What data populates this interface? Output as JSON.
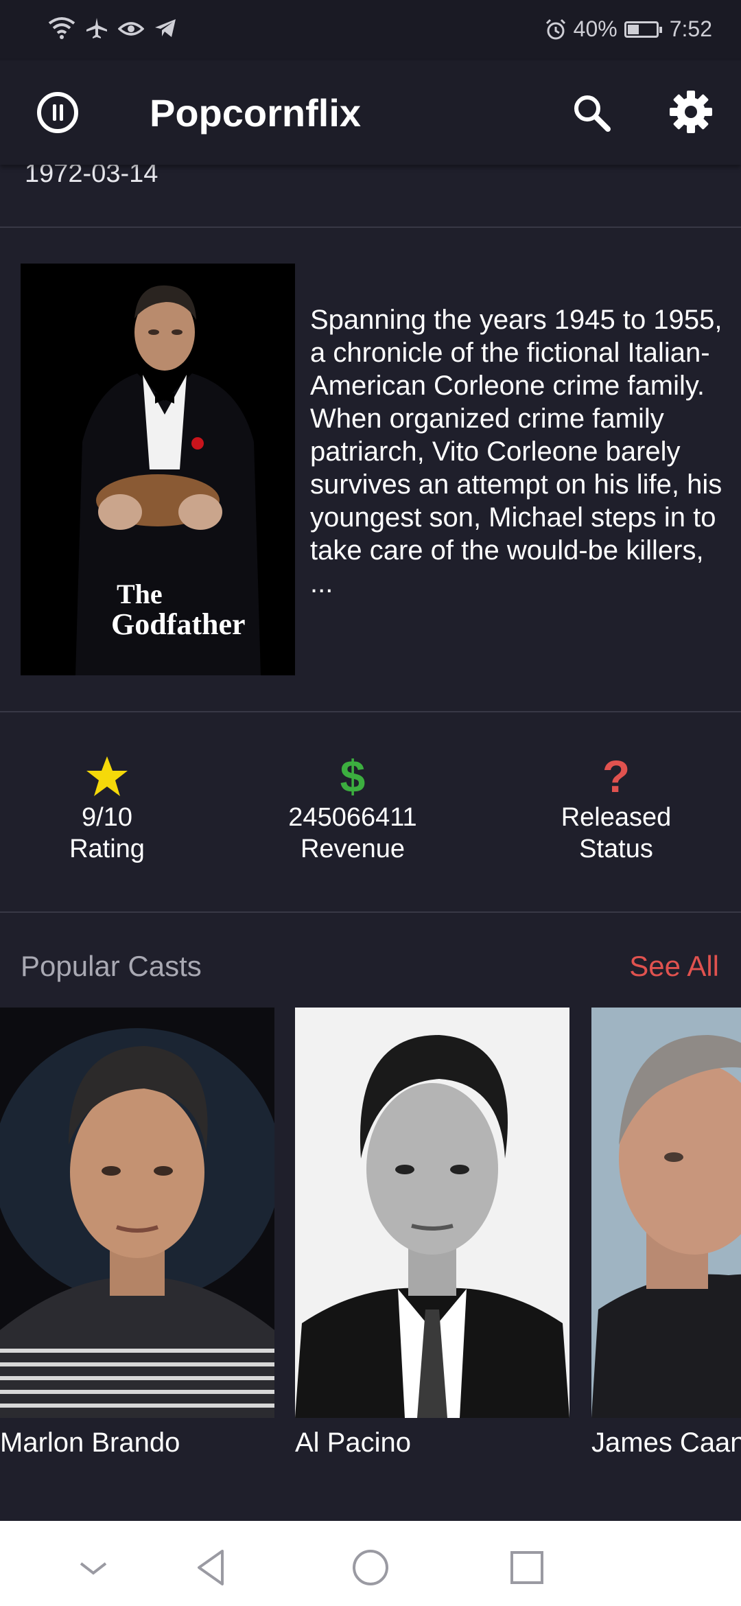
{
  "status_bar": {
    "left_icons": [
      "wifi-icon",
      "airplane-icon",
      "eye-icon",
      "telegram-icon"
    ],
    "alarm_icon": "alarm-icon",
    "battery_percent": "40%",
    "battery_level": 0.4,
    "time": "7:52"
  },
  "app_bar": {
    "title": "Popcornflix",
    "logo_icon": "popcorn-logo-icon",
    "search_icon": "search-icon",
    "settings_icon": "gear-icon"
  },
  "movie": {
    "release_date": "1972-03-14",
    "poster_title_line1": "The",
    "poster_title_line2": "Godfather",
    "overview": "Spanning the years 1945 to 1955, a chronicle of the fictional Italian-American Corleone crime family. When organized crime family patriarch, Vito Corleone barely survives an attempt on his life, his youngest son, Michael steps in to take care of the would-be killers, ..."
  },
  "stats": [
    {
      "icon": "star-icon",
      "value": "9/10",
      "label": "Rating",
      "color": "#f5d90a"
    },
    {
      "icon": "dollar-icon",
      "value": "245066411",
      "label": "Revenue",
      "color": "#3cae3f"
    },
    {
      "icon": "question-icon",
      "value": "Released",
      "label": "Status",
      "color": "#e0524f"
    }
  ],
  "casts_section": {
    "title": "Popular Casts",
    "see_all": "See All",
    "accent_color": "#e0524f"
  },
  "casts": [
    {
      "name": "Marlon Brando"
    },
    {
      "name": "Al Pacino"
    },
    {
      "name": "James Caan"
    }
  ],
  "nav_bar": {
    "icons": [
      "chevron-down-icon",
      "back-icon",
      "home-icon",
      "recents-icon"
    ]
  }
}
